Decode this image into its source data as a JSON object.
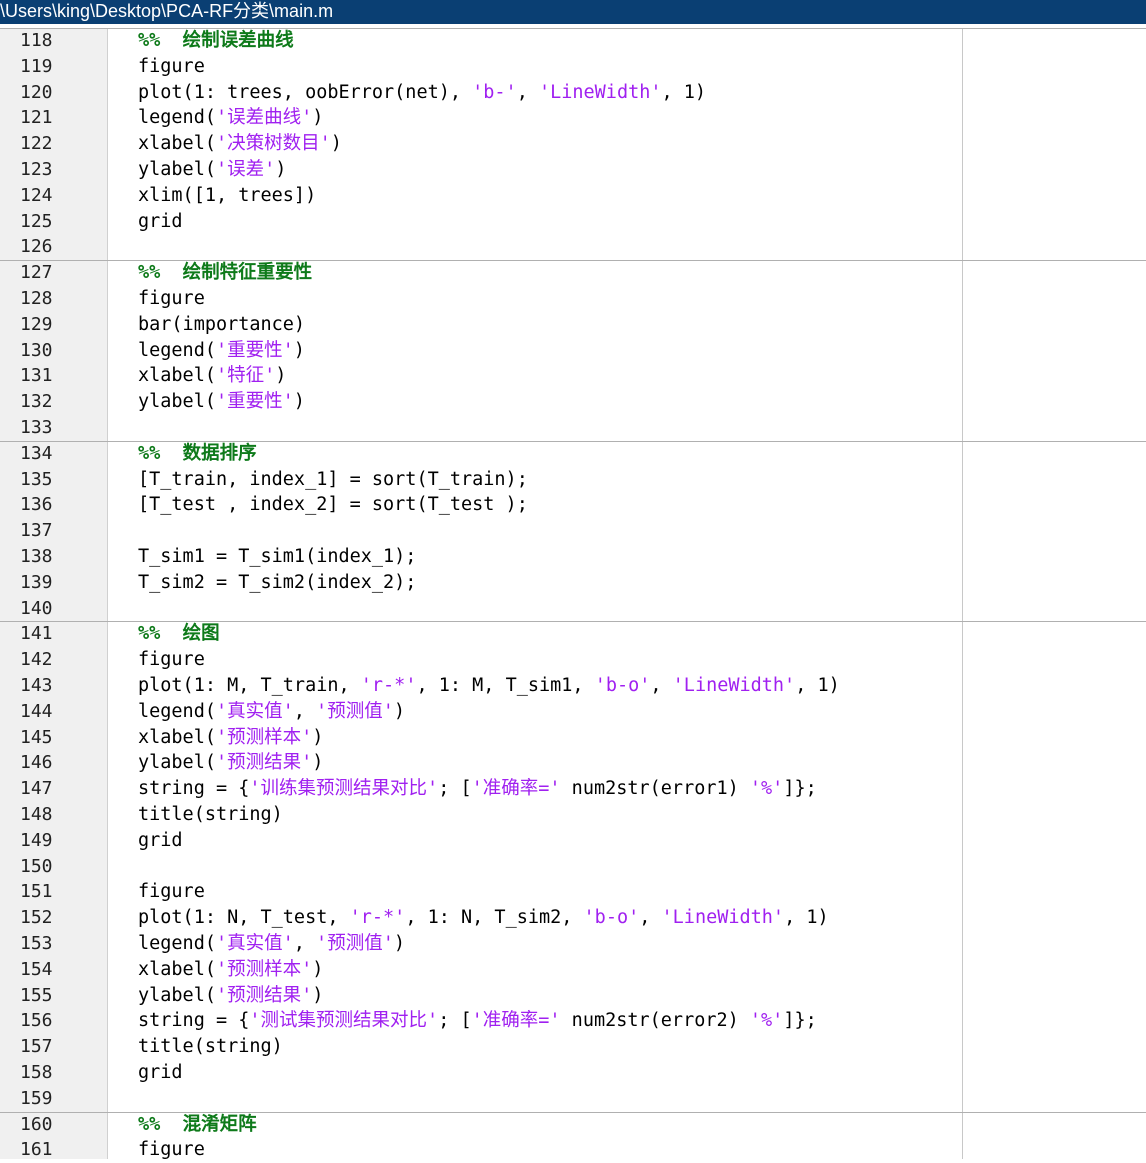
{
  "window": {
    "title": "\\Users\\king\\Desktop\\PCA-RF分类\\main.m"
  },
  "editor": {
    "lines": [
      {
        "n": "118",
        "text": "%%  绘制误差曲线",
        "kind": "cell"
      },
      {
        "n": "119",
        "text": "figure",
        "kind": "code"
      },
      {
        "n": "120",
        "text": "plot(1: trees, oobError(net), 'b-', 'LineWidth', 1)",
        "kind": "code"
      },
      {
        "n": "121",
        "text": "legend('误差曲线')",
        "kind": "code"
      },
      {
        "n": "122",
        "text": "xlabel('决策树数目')",
        "kind": "code"
      },
      {
        "n": "123",
        "text": "ylabel('误差')",
        "kind": "code"
      },
      {
        "n": "124",
        "text": "xlim([1, trees])",
        "kind": "code"
      },
      {
        "n": "125",
        "text": "grid",
        "kind": "code"
      },
      {
        "n": "126",
        "text": "",
        "kind": "code"
      },
      {
        "n": "127",
        "text": "%%  绘制特征重要性",
        "kind": "cell"
      },
      {
        "n": "128",
        "text": "figure",
        "kind": "code"
      },
      {
        "n": "129",
        "text": "bar(importance)",
        "kind": "code"
      },
      {
        "n": "130",
        "text": "legend('重要性')",
        "kind": "code"
      },
      {
        "n": "131",
        "text": "xlabel('特征')",
        "kind": "code"
      },
      {
        "n": "132",
        "text": "ylabel('重要性')",
        "kind": "code"
      },
      {
        "n": "133",
        "text": "",
        "kind": "code"
      },
      {
        "n": "134",
        "text": "%%  数据排序",
        "kind": "cell"
      },
      {
        "n": "135",
        "text": "[T_train, index_1] = sort(T_train);",
        "kind": "code"
      },
      {
        "n": "136",
        "text": "[T_test , index_2] = sort(T_test );",
        "kind": "code"
      },
      {
        "n": "137",
        "text": "",
        "kind": "code"
      },
      {
        "n": "138",
        "text": "T_sim1 = T_sim1(index_1);",
        "kind": "code"
      },
      {
        "n": "139",
        "text": "T_sim2 = T_sim2(index_2);",
        "kind": "code"
      },
      {
        "n": "140",
        "text": "",
        "kind": "code"
      },
      {
        "n": "141",
        "text": "%%  绘图",
        "kind": "cell"
      },
      {
        "n": "142",
        "text": "figure",
        "kind": "code"
      },
      {
        "n": "143",
        "text": "plot(1: M, T_train, 'r-*', 1: M, T_sim1, 'b-o', 'LineWidth', 1)",
        "kind": "code"
      },
      {
        "n": "144",
        "text": "legend('真实值', '预测值')",
        "kind": "code"
      },
      {
        "n": "145",
        "text": "xlabel('预测样本')",
        "kind": "code"
      },
      {
        "n": "146",
        "text": "ylabel('预测结果')",
        "kind": "code"
      },
      {
        "n": "147",
        "text": "string = {'训练集预测结果对比'; ['准确率=' num2str(error1) '%']};",
        "kind": "code"
      },
      {
        "n": "148",
        "text": "title(string)",
        "kind": "code"
      },
      {
        "n": "149",
        "text": "grid",
        "kind": "code"
      },
      {
        "n": "150",
        "text": "",
        "kind": "code"
      },
      {
        "n": "151",
        "text": "figure",
        "kind": "code"
      },
      {
        "n": "152",
        "text": "plot(1: N, T_test, 'r-*', 1: N, T_sim2, 'b-o', 'LineWidth', 1)",
        "kind": "code"
      },
      {
        "n": "153",
        "text": "legend('真实值', '预测值')",
        "kind": "code"
      },
      {
        "n": "154",
        "text": "xlabel('预测样本')",
        "kind": "code"
      },
      {
        "n": "155",
        "text": "ylabel('预测结果')",
        "kind": "code"
      },
      {
        "n": "156",
        "text": "string = {'测试集预测结果对比'; ['准确率=' num2str(error2) '%']};",
        "kind": "code"
      },
      {
        "n": "157",
        "text": "title(string)",
        "kind": "code"
      },
      {
        "n": "158",
        "text": "grid",
        "kind": "code"
      },
      {
        "n": "159",
        "text": "",
        "kind": "code"
      },
      {
        "n": "160",
        "text": "%%  混淆矩阵",
        "kind": "cell"
      },
      {
        "n": "161",
        "text": "figure",
        "kind": "code"
      }
    ]
  },
  "colors": {
    "title_bar": "#0a3f73",
    "comment": "#0e7a1a",
    "string": "#a020f0",
    "gutter": "#f0f0f0"
  }
}
